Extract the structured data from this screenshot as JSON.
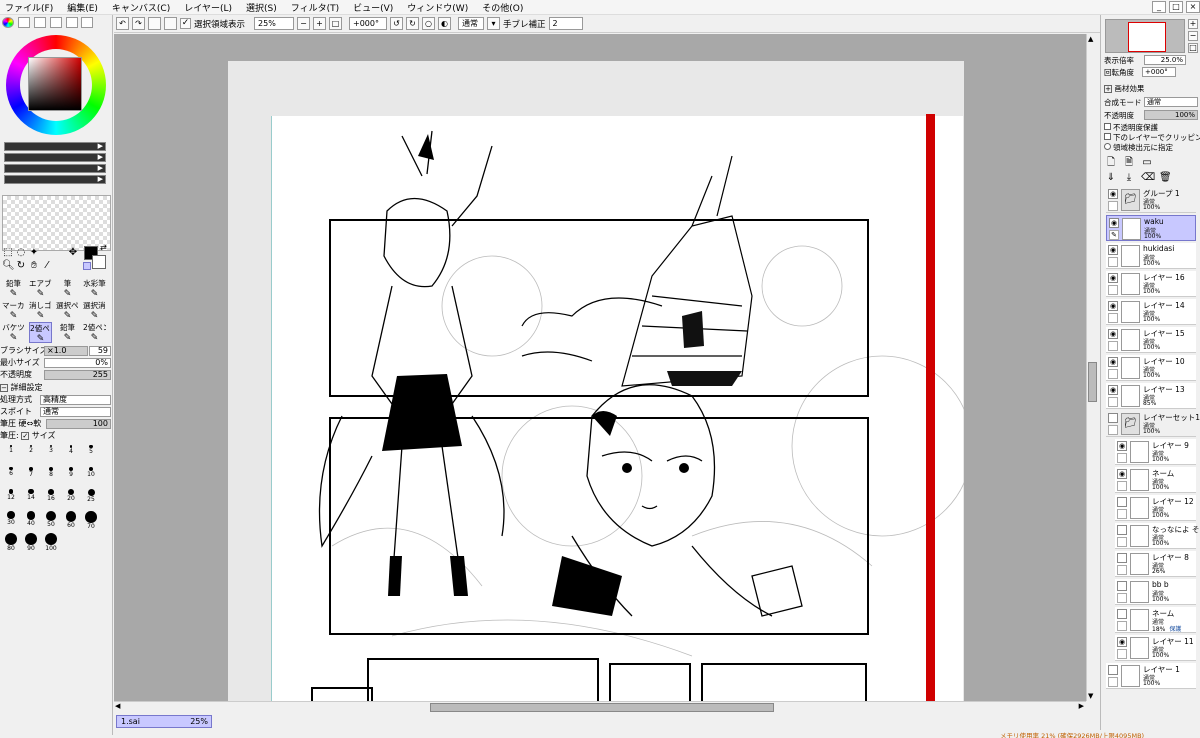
{
  "menu": [
    "ファイル(F)",
    "編集(E)",
    "キャンバス(C)",
    "レイヤー(L)",
    "選択(S)",
    "フィルタ(T)",
    "ビュー(V)",
    "ウィンドウ(W)",
    "その他(O)"
  ],
  "toolbar": {
    "show_selection_label": "選択領域表示",
    "zoom": "25%",
    "rotation": "+000°",
    "blend": "通常",
    "stabilizer_label": "手ブレ補正",
    "stabilizer_value": "2"
  },
  "left": {
    "brushes": [
      {
        "label": "鉛筆"
      },
      {
        "label": "エアブラシ"
      },
      {
        "label": "筆"
      },
      {
        "label": "水彩筆"
      },
      {
        "label": "マーカー"
      },
      {
        "label": "消しゴム"
      },
      {
        "label": "選択ペン"
      },
      {
        "label": "選択消し"
      },
      {
        "label": "バケツ"
      },
      {
        "label": "2値ペン"
      },
      {
        "label": "鉛筆"
      },
      {
        "label": "2値ペン"
      }
    ],
    "brush_size_label": "ブラシサイズ",
    "brush_size_mult": "×1.0",
    "brush_size_value": "59",
    "min_size_label": "最小サイズ",
    "min_size_value": "0%",
    "density_label": "不透明度",
    "density_value": "255",
    "advanced_label": "詳細設定",
    "quality_label": "処理方式",
    "quality_value": "高精度",
    "edge_label": "スポイト",
    "edge_value": "通常",
    "pressure_label": "筆圧 硬⇔軟",
    "pressure_value": "100",
    "pressure_size_label": "筆圧:",
    "pressure_size_check": "サイズ",
    "dot_sizes": [
      "1",
      "2",
      "3",
      "4",
      "5",
      "6",
      "7",
      "8",
      "9",
      "10",
      "12",
      "14",
      "16",
      "20",
      "25",
      "30",
      "40",
      "50",
      "60",
      "70",
      "80",
      "90",
      "100"
    ]
  },
  "right": {
    "display_zoom_label": "表示倍率",
    "display_zoom_value": "25.0%",
    "rotation_label": "回転角度",
    "rotation_value": "+000°",
    "texture_label": "画材効果",
    "blend_label": "合成モード",
    "blend_value": "通常",
    "opacity_label": "不透明度",
    "opacity_value": "100%",
    "checks": [
      "不透明度保護",
      "下のレイヤーでクリッピング",
      "領域検出元に指定"
    ],
    "layers": [
      {
        "name": "グループ 1",
        "mode": "通常",
        "opacity": "100%",
        "tag": "",
        "type": "group"
      },
      {
        "name": "waku",
        "mode": "通常",
        "opacity": "100%",
        "tag": "",
        "type": "selected"
      },
      {
        "name": "hukidasi",
        "mode": "通常",
        "opacity": "100%",
        "tag": "",
        "type": "layer"
      },
      {
        "name": "レイヤー 16",
        "mode": "通常",
        "opacity": "100%",
        "tag": "",
        "type": "layer"
      },
      {
        "name": "レイヤー 14",
        "mode": "通常",
        "opacity": "100%",
        "tag": "",
        "type": "layer"
      },
      {
        "name": "レイヤー 15",
        "mode": "通常",
        "opacity": "100%",
        "tag": "",
        "type": "layer"
      },
      {
        "name": "レイヤー 10",
        "mode": "通常",
        "opacity": "100%",
        "tag": "",
        "type": "layer"
      },
      {
        "name": "レイヤー 13",
        "mode": "通常",
        "opacity": "85%",
        "tag": "",
        "type": "layer"
      },
      {
        "name": "レイヤーセット1",
        "mode": "通常",
        "opacity": "100%",
        "tag": "",
        "type": "group"
      },
      {
        "name": "レイヤー 9",
        "mode": "通常",
        "opacity": "100%",
        "tag": "",
        "type": "indent"
      },
      {
        "name": "ネーム",
        "mode": "通常",
        "opacity": "100%",
        "tag": "",
        "type": "indent"
      },
      {
        "name": "レイヤー 12",
        "mode": "通常",
        "opacity": "100%",
        "tag": "",
        "type": "indent"
      },
      {
        "name": "なっなによ そ…",
        "mode": "通常",
        "opacity": "100%",
        "tag": "",
        "type": "indent"
      },
      {
        "name": "レイヤー 8",
        "mode": "通常",
        "opacity": "26%",
        "tag": "",
        "type": "indent"
      },
      {
        "name": "bb b",
        "mode": "通常",
        "opacity": "100%",
        "tag": "",
        "type": "indent"
      },
      {
        "name": "ネーム",
        "mode": "通常",
        "opacity": "18%",
        "tag": "保護",
        "type": "indent"
      },
      {
        "name": "レイヤー 11",
        "mode": "通常",
        "opacity": "100%",
        "tag": "",
        "type": "indent"
      },
      {
        "name": "レイヤー 1",
        "mode": "通常",
        "opacity": "100%",
        "tag": "",
        "type": "layer"
      }
    ]
  },
  "doc_tab": {
    "name": "1.sai",
    "zoom": "25%"
  },
  "status": "メモリ使用率 21% (確保2926MB/上限4095MB)"
}
